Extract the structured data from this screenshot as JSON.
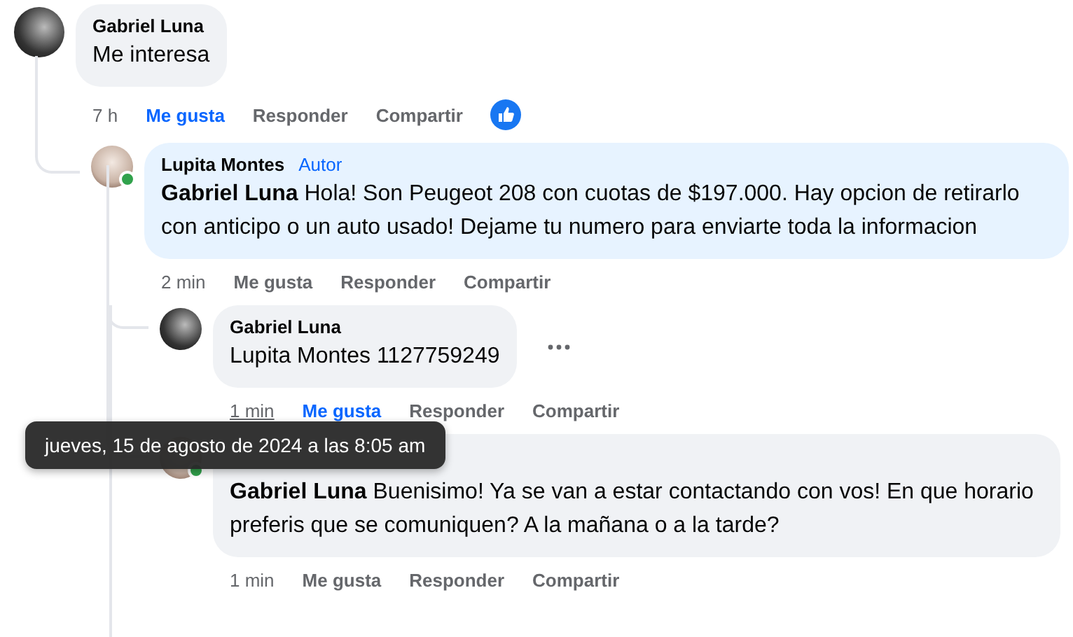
{
  "comments": [
    {
      "author": "Gabriel Luna",
      "avatar": {
        "kind": "dark"
      },
      "text": "Me interesa",
      "time": "7 h",
      "time_hovered": false,
      "actions": [
        {
          "label": "Me gusta",
          "selected": true
        },
        {
          "label": "Responder",
          "selected": false
        },
        {
          "label": "Compartir",
          "selected": false
        }
      ],
      "reactions": [
        {
          "kind": "like"
        }
      ],
      "children": [
        {
          "author": "Lupita Montes",
          "badge": "Autor",
          "avatar": {
            "kind": "light"
          },
          "online": true,
          "text": "**Gabriel Luna** Hola! Son Peugeot 208 con cuotas de $197.000. Hay opcion de retirarlo con anticipo o un auto usado! Dejame tu numero para enviarte toda la informacion",
          "time": "2 min",
          "time_hovered": false,
          "actions": [
            {
              "label": "Me gusta",
              "selected": false
            },
            {
              "label": "Responder",
              "selected": false
            },
            {
              "label": "Compartir",
              "selected": false
            }
          ],
          "children": [
            {
              "author": "Gabriel Luna",
              "avatar": {
                "kind": "dark"
              },
              "text": "Lupita Montes 1127759249",
              "time": "1 min",
              "time_hovered": true,
              "tooltip": "jueves, 15 de agosto de 2024 a las 8:05 am",
              "actions": [
                {
                  "label": "Me gusta",
                  "selected": true
                },
                {
                  "label": "Responder",
                  "selected": false
                },
                {
                  "label": "Compartir",
                  "selected": false
                }
              ],
              "more": true
            },
            {
              "avatar": {
                "kind": "light"
              },
              "online": true,
              "text": "**Gabriel Luna** Buenisimo! Ya se van a estar contactando con vos! En que horario preferis que se comuniquen? A la mañana o a la tarde?",
              "time": "1 min",
              "time_hovered": false,
              "actions": [
                {
                  "label": "Me gusta",
                  "selected": false
                },
                {
                  "label": "Responder",
                  "selected": false
                },
                {
                  "label": "Compartir",
                  "selected": false
                }
              ]
            }
          ]
        }
      ]
    }
  ]
}
